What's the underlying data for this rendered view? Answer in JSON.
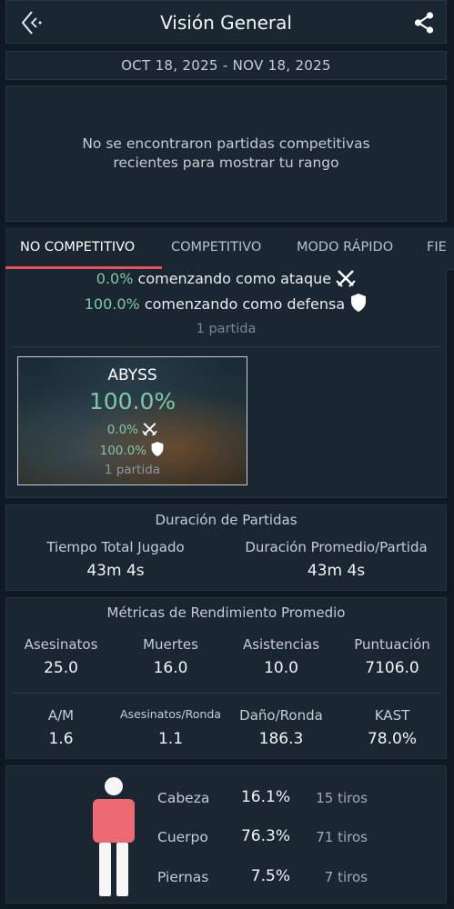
{
  "header": {
    "title": "Visión General",
    "back_icon": "back-arrow-icon",
    "share_icon": "share-icon"
  },
  "date_range": "OCT 18, 2025 - NOV 18, 2025",
  "rank_message": {
    "line1": "No se encontraron partidas competitivas",
    "line2": "recientes para mostrar tu rango"
  },
  "tabs": [
    {
      "label": "NO COMPETITIVO",
      "active": true
    },
    {
      "label": "COMPETITIVO",
      "active": false
    },
    {
      "label": "MODO RÁPIDO",
      "active": false
    },
    {
      "label": "FIE",
      "active": false
    }
  ],
  "sides": {
    "attack_pct": "0.0%",
    "attack_label": "comenzando como ataque",
    "defense_pct": "100.0%",
    "defense_label": "comenzando como defensa",
    "matches": "1 partida"
  },
  "map_card": {
    "name": "ABYSS",
    "winrate": "100.0%",
    "attack_pct": "0.0%",
    "defense_pct": "100.0%",
    "matches": "1 partida"
  },
  "duration": {
    "title": "Duración de Partidas",
    "total_label": "Tiempo Total Jugado",
    "total_value": "43m 4s",
    "avg_label": "Duración Promedio/Partida",
    "avg_value": "43m 4s"
  },
  "metrics": {
    "title": "Métricas de Rendimiento Promedio",
    "row1": [
      {
        "label": "Asesinatos",
        "value": "25.0"
      },
      {
        "label": "Muertes",
        "value": "16.0"
      },
      {
        "label": "Asistencias",
        "value": "10.0"
      },
      {
        "label": "Puntuación",
        "value": "7106.0"
      }
    ],
    "row2": [
      {
        "label": "A/M",
        "value": "1.6"
      },
      {
        "label": "Asesinatos/Ronda",
        "value": "1.1"
      },
      {
        "label": "Daño/Ronda",
        "value": "186.3"
      },
      {
        "label": "KAST",
        "value": "78.0%"
      }
    ]
  },
  "hits": {
    "head": {
      "label": "Cabeza",
      "pct": "16.1%",
      "shots": "15 tiros"
    },
    "body": {
      "label": "Cuerpo",
      "pct": "76.3%",
      "shots": "71 tiros"
    },
    "legs": {
      "label": "Piernas",
      "pct": "7.5%",
      "shots": "7 tiros"
    }
  },
  "colors": {
    "accent": "#e8505b",
    "positive": "#7ec9a5",
    "background": "#0f1922",
    "panel": "#1a2733"
  }
}
